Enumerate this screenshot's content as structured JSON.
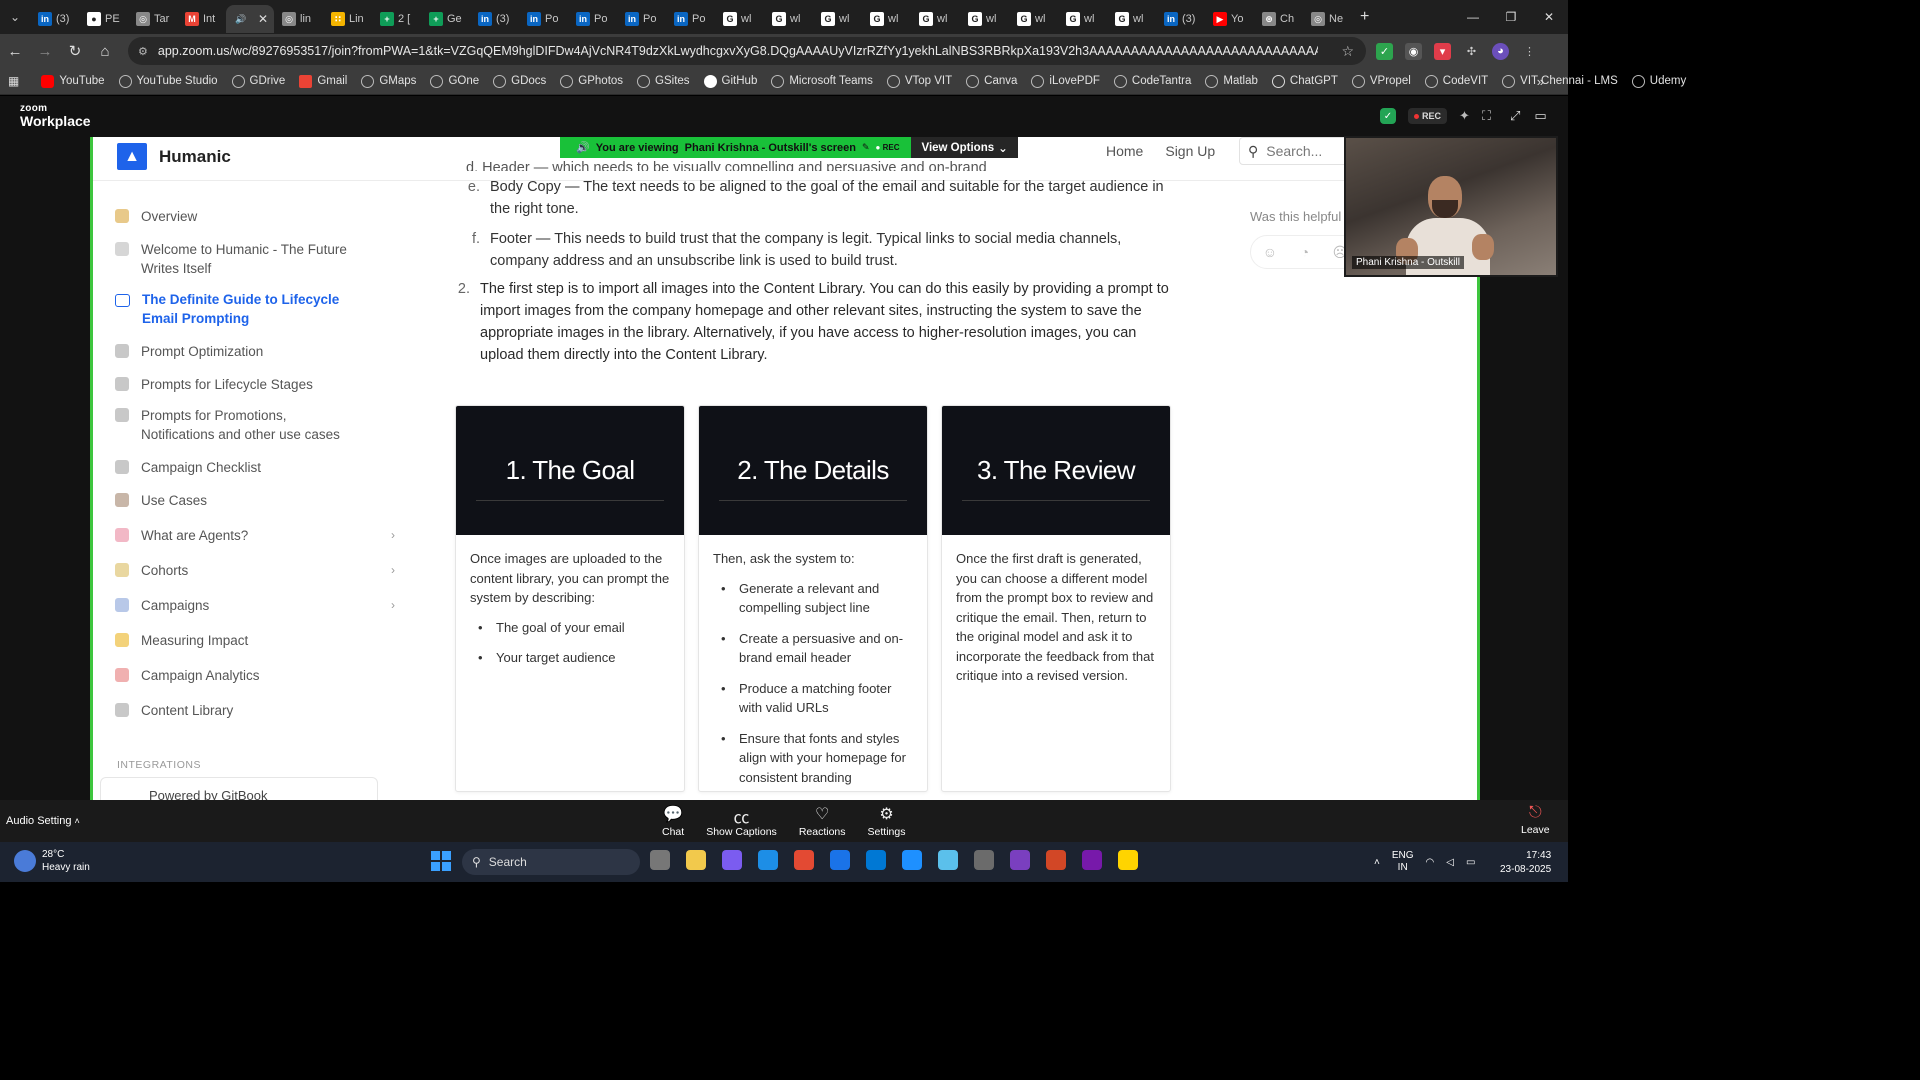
{
  "browser": {
    "tabs": [
      {
        "label": "(3)",
        "icon": "linkedin-icon",
        "color": "#0a66c2",
        "glyph": "in"
      },
      {
        "label": "PE",
        "icon": "github-icon",
        "color": "#ffffff",
        "glyph": "●"
      },
      {
        "label": "Tar",
        "icon": "globe-icon",
        "color": "#888888",
        "glyph": "◎"
      },
      {
        "label": "Int",
        "icon": "gmail-icon",
        "color": "#ea4335",
        "glyph": "M"
      },
      {
        "label": "",
        "icon": "speaker-icon",
        "color": "#3c3c3c",
        "glyph": "🔊",
        "active": true
      },
      {
        "label": "lin",
        "icon": "globe-icon",
        "color": "#888888",
        "glyph": "◎"
      },
      {
        "label": "Lin",
        "icon": "dots-icon",
        "color": "#f4b400",
        "glyph": "∷"
      },
      {
        "label": "2 [",
        "icon": "sheets-icon",
        "color": "#0f9d58",
        "glyph": "+"
      },
      {
        "label": "Ge",
        "icon": "sheets-icon",
        "color": "#0f9d58",
        "glyph": "+"
      },
      {
        "label": "(3)",
        "icon": "linkedin-icon",
        "color": "#0a66c2",
        "glyph": "in"
      },
      {
        "label": "Po",
        "icon": "linkedin-icon",
        "color": "#0a66c2",
        "glyph": "in"
      },
      {
        "label": "Po",
        "icon": "linkedin-icon",
        "color": "#0a66c2",
        "glyph": "in"
      },
      {
        "label": "Po",
        "icon": "linkedin-icon",
        "color": "#0a66c2",
        "glyph": "in"
      },
      {
        "label": "Po",
        "icon": "linkedin-icon",
        "color": "#0a66c2",
        "glyph": "in"
      },
      {
        "label": "wl",
        "icon": "google-icon",
        "color": "#ffffff",
        "glyph": "G"
      },
      {
        "label": "wl",
        "icon": "google-icon",
        "color": "#ffffff",
        "glyph": "G"
      },
      {
        "label": "wl",
        "icon": "google-icon",
        "color": "#ffffff",
        "glyph": "G"
      },
      {
        "label": "wl",
        "icon": "google-icon",
        "color": "#ffffff",
        "glyph": "G"
      },
      {
        "label": "wl",
        "icon": "google-icon",
        "color": "#ffffff",
        "glyph": "G"
      },
      {
        "label": "wl",
        "icon": "google-icon",
        "color": "#ffffff",
        "glyph": "G"
      },
      {
        "label": "wl",
        "icon": "google-icon",
        "color": "#ffffff",
        "glyph": "G"
      },
      {
        "label": "wl",
        "icon": "google-icon",
        "color": "#ffffff",
        "glyph": "G"
      },
      {
        "label": "wl",
        "icon": "google-icon",
        "color": "#ffffff",
        "glyph": "G"
      },
      {
        "label": "(3)",
        "icon": "linkedin-icon",
        "color": "#0a66c2",
        "glyph": "in"
      },
      {
        "label": "Yo",
        "icon": "youtube-icon",
        "color": "#ff0000",
        "glyph": "▶"
      },
      {
        "label": "Ch",
        "icon": "chatgpt-icon",
        "color": "#888888",
        "glyph": "⊛"
      },
      {
        "label": "Ne",
        "icon": "globe-icon",
        "color": "#888888",
        "glyph": "◎"
      }
    ],
    "url": "app.zoom.us/wc/89276953517/join?fromPWA=1&tk=VZGqQEM9hglDIFDw4AjVcNR4T9dzXkLwydhcgxvXyG8.DQgAAAAUyVIzrRZfYy1yekhLalNBS3RBRkpXa193V2h3AAAAAAAAAAAAAAAAAAAAAAAAAAAAAAAAAAAAAAA&_x_zm_r...",
    "bookmarks": [
      {
        "label": "YouTube",
        "type": "yt"
      },
      {
        "label": "YouTube Studio",
        "type": ""
      },
      {
        "label": "GDrive",
        "type": ""
      },
      {
        "label": "Gmail",
        "type": "gm"
      },
      {
        "label": "GMaps",
        "type": ""
      },
      {
        "label": "GOne",
        "type": ""
      },
      {
        "label": "GDocs",
        "type": ""
      },
      {
        "label": "GPhotos",
        "type": ""
      },
      {
        "label": "GSites",
        "type": ""
      },
      {
        "label": "GitHub",
        "type": "gh"
      },
      {
        "label": "Microsoft Teams",
        "type": ""
      },
      {
        "label": "VTop VIT",
        "type": ""
      },
      {
        "label": "Canva",
        "type": ""
      },
      {
        "label": "iLovePDF",
        "type": ""
      },
      {
        "label": "CodeTantra",
        "type": ""
      },
      {
        "label": "Matlab",
        "type": ""
      },
      {
        "label": "ChatGPT",
        "type": "gpt"
      },
      {
        "label": "VPropel",
        "type": ""
      },
      {
        "label": "CodeVIT",
        "type": ""
      },
      {
        "label": "VIT Chennai - LMS",
        "type": ""
      },
      {
        "label": "Udemy",
        "type": ""
      }
    ],
    "more": "»"
  },
  "zoom": {
    "logo_small": "zoom",
    "logo_big": "Workplace",
    "rec": "REC",
    "viewing_text": "You are viewing",
    "viewing_name": "Phani Krishna - Outskill's screen",
    "viewing_rec": "REC",
    "view_options": "View Options",
    "participant_name": "Phani Krishna - Outskill",
    "audio_setting": "Audio Setting",
    "toolbar": {
      "chat": "Chat",
      "captions": "Show Captions",
      "reactions": "Reactions",
      "settings": "Settings",
      "leave": "Leave"
    }
  },
  "gitbook": {
    "brand": "Humanic",
    "nav": {
      "home": "Home",
      "signup": "Sign Up",
      "search": "Search..."
    },
    "sidebar": [
      {
        "label": "Overview",
        "color": "#e8c98a"
      },
      {
        "label": "Welcome to Humanic - The Future Writes Itself",
        "color": "#d6d6d6"
      },
      {
        "label": "The Definite Guide to Lifecycle Email Prompting",
        "active": true
      },
      {
        "label": "Prompt Optimization",
        "color": "#c8c8c8"
      },
      {
        "label": "Prompts for Lifecycle Stages",
        "color": "#c8c8c8"
      },
      {
        "label": "Prompts for Promotions, Notifications and other use cases",
        "color": "#c8c8c8"
      },
      {
        "label": "Campaign Checklist",
        "color": "#c8c8c8"
      },
      {
        "label": "Use Cases",
        "color": "#c8b6a8"
      },
      {
        "label": "What are Agents?",
        "color": "#f2b8c6",
        "chev": true
      },
      {
        "label": "Cohorts",
        "color": "#e9d7a0",
        "chev": true
      },
      {
        "label": "Campaigns",
        "color": "#b8c8e8",
        "chev": true
      },
      {
        "label": "Measuring Impact",
        "color": "#f3d27a"
      },
      {
        "label": "Campaign Analytics",
        "color": "#f0b0b0"
      },
      {
        "label": "Content Library",
        "color": "#c8c8c8"
      }
    ],
    "integrations": "INTEGRATIONS",
    "powered": "Powered by GitBook",
    "list_top_cut": "d.  Header — which needs to be visually compelling and persuasive and on-brand",
    "list_items": [
      {
        "marker": "e.",
        "text": "Body Copy — The text needs to be aligned to the goal of the email and suitable for the target audience in the right tone."
      },
      {
        "marker": "f.",
        "text": "Footer — This needs to build trust that the company is legit. Typical links to social media channels, company address and an unsubscribe link is used to build trust."
      }
    ],
    "step2": {
      "marker": "2.",
      "text": "The first step is to import all images into the Content Library. You can do this easily by providing a prompt to import images from the company homepage and other relevant sites, instructing the system to save the appropriate images in the library. Alternatively, if you have access to higher-resolution images, you can upload them directly into the Content Library."
    },
    "cards": [
      {
        "title": "1. The Goal",
        "intro": "Once images are uploaded to the content library, you can prompt the system by describing:",
        "bullets": [
          "The goal of your email",
          "Your target audience"
        ]
      },
      {
        "title": "2. The Details",
        "intro": "Then, ask the system to:",
        "bullets": [
          "Generate a relevant and compelling subject line",
          "Create a persuasive and on-brand email header",
          "Produce a matching footer with valid URLs",
          "Ensure that fonts and styles align with your homepage for consistent branding"
        ]
      },
      {
        "title": "3. The Review",
        "intro": "Once the first draft is generated, you can choose a different model from the prompt box to review and critique the email. Then, return to the original model and ask it to incorporate the feedback from that critique into a revised version.",
        "bullets": []
      }
    ],
    "helpful": "Was this helpful"
  },
  "taskbar": {
    "temp": "28°C",
    "weather": "Heavy rain",
    "search": "Search",
    "lang1": "ENG",
    "lang2": "IN",
    "time": "17:43",
    "date": "23-08-2025",
    "apps": [
      "#777777",
      "#f2c94c",
      "#7b5cf0",
      "#1d8ee6",
      "#e34a33",
      "#1a73e8",
      "#0078d4",
      "#1e90ff",
      "#5bc0eb",
      "#6b6b6b",
      "#7a3fbf",
      "#d24726",
      "#7719aa",
      "#ffd400"
    ]
  }
}
